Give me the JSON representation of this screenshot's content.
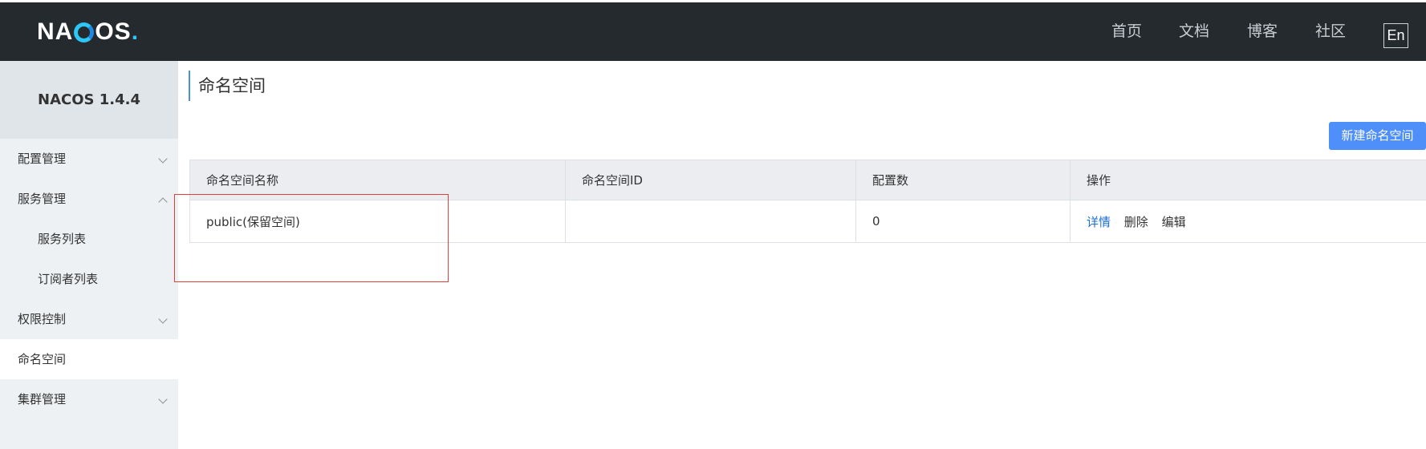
{
  "header": {
    "logo": "NACOS",
    "nav": [
      {
        "label": "首页"
      },
      {
        "label": "文档"
      },
      {
        "label": "博客"
      },
      {
        "label": "社区"
      }
    ],
    "lang_button": "En"
  },
  "sidebar": {
    "title": "NACOS 1.4.4",
    "items": [
      {
        "label": "配置管理",
        "expanded": false
      },
      {
        "label": "服务管理",
        "expanded": true
      },
      {
        "label": "服务列表",
        "sub": true
      },
      {
        "label": "订阅者列表",
        "sub": true
      },
      {
        "label": "权限控制",
        "expanded": false
      },
      {
        "label": "命名空间",
        "active": true
      },
      {
        "label": "集群管理",
        "expanded": false
      }
    ]
  },
  "main": {
    "title": "命名空间",
    "create_button": "新建命名空间",
    "table": {
      "headers": [
        "命名空间名称",
        "命名空间ID",
        "配置数",
        "操作"
      ],
      "rows": [
        {
          "name": "public(保留空间)",
          "id": "",
          "config_count": "0",
          "actions": [
            "详情",
            "删除",
            "编辑"
          ]
        }
      ]
    }
  },
  "colors": {
    "topbar_bg": "#252a2f",
    "sidebar_bg": "#eef1f3",
    "primary_button": "#4f8ffa",
    "link": "#1a6fd1",
    "highlight_box": "#e0403a"
  }
}
